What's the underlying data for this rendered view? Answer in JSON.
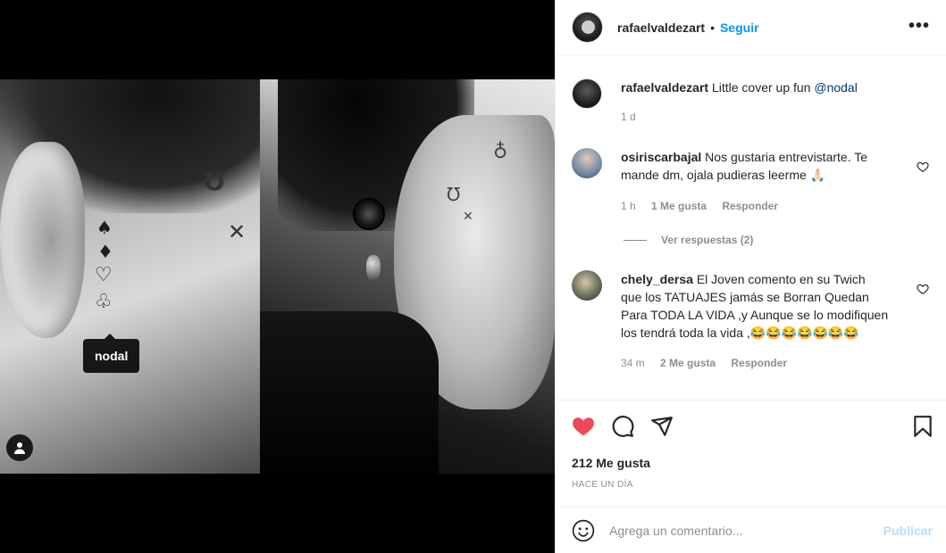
{
  "post": {
    "author": "rafaelvaldezart",
    "follow_label": "Seguir",
    "separator": "•",
    "more_label": "•••",
    "tag_tooltip": "nodal"
  },
  "caption": {
    "author": "rafaelvaldezart",
    "text": "Little cover up fun",
    "mention": "@nodal",
    "time": "1 d"
  },
  "comments": [
    {
      "author": "osiriscarbajal",
      "text": "Nos gustaria entrevistarte. Te mande dm, ojala pudieras leerme 🙏🏻",
      "time": "1 h",
      "likes": "1 Me gusta",
      "reply_label": "Responder",
      "view_replies": "Ver respuestas (2)"
    },
    {
      "author": "chely_dersa",
      "text": "El Joven comento en su Twich que los TATUAJES jamás se Borran Quedan Para TODA LA VIDA ,y Aunque se lo modifiquen los tendrá toda la vida ,😂😂😂😂😂😂😂",
      "time": "34 m",
      "likes": "2 Me gusta",
      "reply_label": "Responder"
    }
  ],
  "stats": {
    "likes": "212 Me gusta",
    "posted": "HACE UN DÍA"
  },
  "composer": {
    "placeholder": "Agrega un comentario...",
    "publish_label": "Publicar"
  },
  "colors": {
    "like_red": "#ed4956",
    "link_blue": "#0095f6",
    "mention_blue": "#00376b",
    "muted": "#8e8e8e"
  },
  "icons": [
    "heart-filled-icon",
    "comment-icon",
    "share-icon",
    "bookmark-icon",
    "emoji-icon",
    "user-tag-icon",
    "more-icon",
    "heart-outline-icon"
  ]
}
